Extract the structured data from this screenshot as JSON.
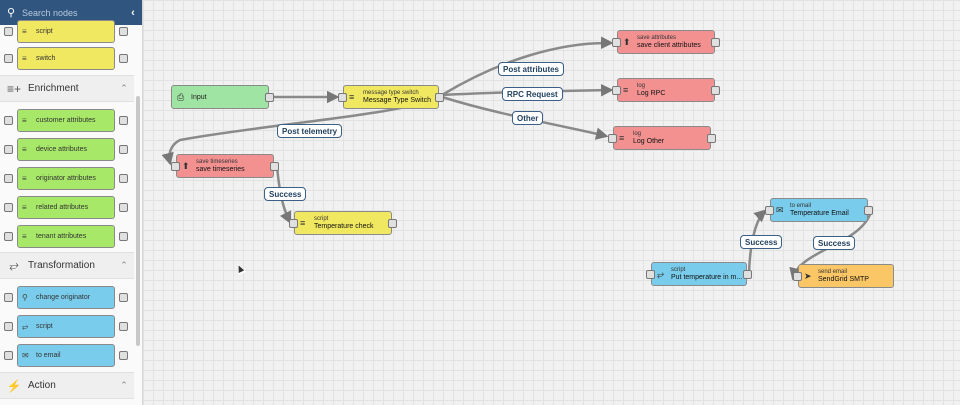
{
  "search": {
    "placeholder": "Search nodes"
  },
  "sidebar": {
    "partial_nodes": [
      {
        "label": "script",
        "color": "#f1e861"
      },
      {
        "label": "switch",
        "color": "#f1e861"
      }
    ],
    "sections": [
      {
        "title": "Enrichment",
        "icon": "enrichment-icon"
      },
      {
        "title": "Transformation",
        "icon": "transformation-icon"
      },
      {
        "title": "Action",
        "icon": "lightning-icon"
      }
    ],
    "enrichment_nodes": [
      {
        "label": "customer attributes"
      },
      {
        "label": "device attributes"
      },
      {
        "label": "originator attributes"
      },
      {
        "label": "related attributes"
      },
      {
        "label": "tenant attributes"
      }
    ],
    "transformation_nodes": [
      {
        "label": "change originator"
      },
      {
        "label": "script"
      },
      {
        "label": "to email"
      }
    ]
  },
  "canvas": {
    "nodes": {
      "input": {
        "title": "Input"
      },
      "msg_switch": {
        "type": "message type switch",
        "name": "Message Type Switch"
      },
      "save_attributes": {
        "type": "save attributes",
        "name": "save client attributes"
      },
      "log_rpc": {
        "type": "log",
        "name": "Log RPC"
      },
      "log_other": {
        "type": "log",
        "name": "Log Other"
      },
      "save_timeseries": {
        "type": "save timeseries",
        "name": "save timeseries"
      },
      "temp_check": {
        "type": "script",
        "name": "Temperature check"
      },
      "to_email": {
        "type": "to email",
        "name": "Temperature Email"
      },
      "put_temp": {
        "type": "script",
        "name": "Put temperature in m..."
      },
      "send_email": {
        "type": "send email",
        "name": "SendGrid SMTP"
      }
    },
    "edge_labels": {
      "post_attributes": "Post attributes",
      "rpc_request": "RPC Request",
      "other": "Other",
      "post_telemetry": "Post telemetry",
      "success_1": "Success",
      "success_2": "Success",
      "success_3": "Success"
    }
  }
}
